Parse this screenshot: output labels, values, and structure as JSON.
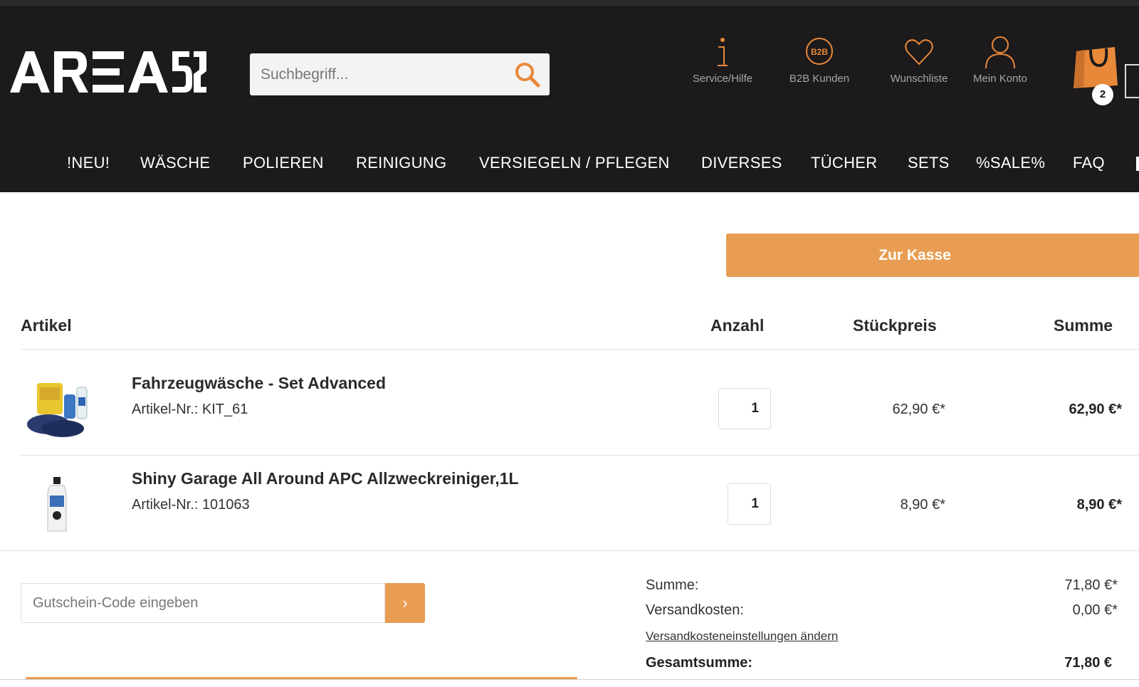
{
  "header": {
    "logo_text": "AREA 52",
    "search": {
      "placeholder": "Suchbegriff..."
    },
    "icons": [
      {
        "name": "info-icon",
        "label": "Service/Hilfe"
      },
      {
        "name": "b2b-icon",
        "label": "B2B Kunden",
        "glyph_text": "B2B"
      },
      {
        "name": "heart-icon",
        "label": "Wunschliste"
      },
      {
        "name": "user-icon",
        "label": "Mein Konto"
      }
    ],
    "cart_count": "2"
  },
  "nav": [
    "!NEU!",
    "WÄSCHE",
    "POLIEREN",
    "REINIGUNG",
    "VERSIEGELN / PFLEGEN",
    "DIVERSES",
    "TÜCHER",
    "SETS",
    "%SALE%",
    "FAQ"
  ],
  "checkout_label": "Zur Kasse",
  "table": {
    "headers": {
      "article": "Artikel",
      "qty": "Anzahl",
      "unit": "Stückpreis",
      "total": "Summe"
    },
    "rows": [
      {
        "name": "Fahrzeugwäsche - Set Advanced",
        "sku": "Artikel-Nr.: KIT_61",
        "qty": "1",
        "unit": "62,90 €*",
        "total": "62,90 €*"
      },
      {
        "name": "Shiny Garage All Around APC Allzweckreiniger,1L",
        "sku": "Artikel-Nr.: 101063",
        "qty": "1",
        "unit": "8,90 €*",
        "total": "8,90 €*"
      }
    ]
  },
  "voucher": {
    "placeholder": "Gutschein-Code eingeben",
    "button": "›"
  },
  "summary": {
    "subtotal_label": "Summe:",
    "subtotal": "71,80 €*",
    "shipping_label": "Versandkosten:",
    "shipping": "0,00 €*",
    "shipping_link": "Versandkosteneinstellungen ändern",
    "grand_label": "Gesamtsumme:",
    "grand": "71,80 €"
  },
  "colors": {
    "accent": "#e89d52",
    "header_bg": "#1c1a1b"
  }
}
